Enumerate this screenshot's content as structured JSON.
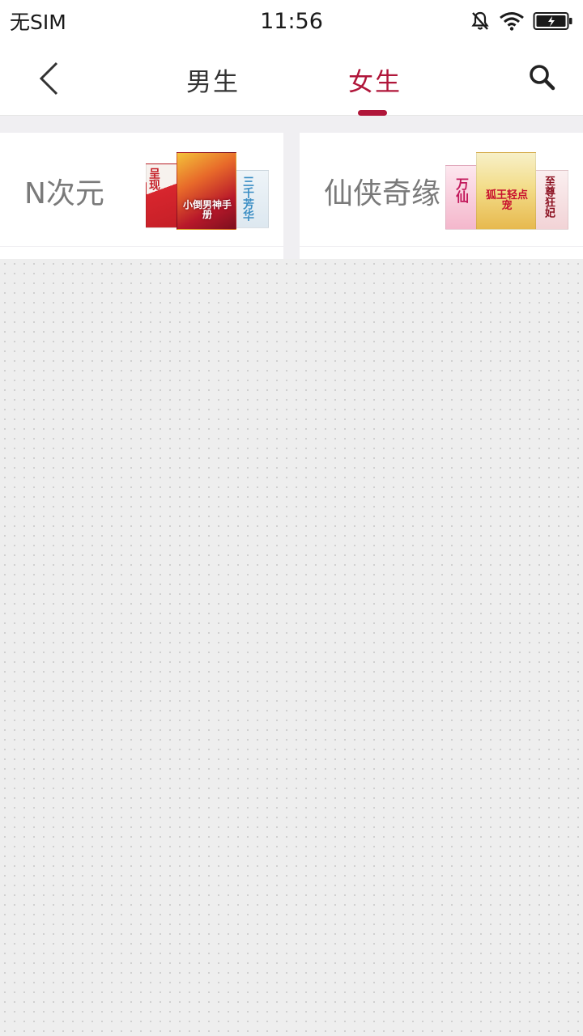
{
  "status_bar": {
    "carrier": "无SIM",
    "time": "11:56"
  },
  "nav": {
    "tabs": [
      {
        "label": "男生",
        "selected": false
      },
      {
        "label": "女生",
        "selected": true
      }
    ],
    "accent_color": "#b0163a"
  },
  "categories": [
    {
      "title": "N次元",
      "cover_texts": [
        "呈现",
        "小倒男神手册",
        "三千芳华"
      ]
    },
    {
      "title": "仙侠奇缘",
      "cover_texts": [
        "万仙",
        "狐王轻点宠",
        "至尊狂妃"
      ]
    }
  ]
}
